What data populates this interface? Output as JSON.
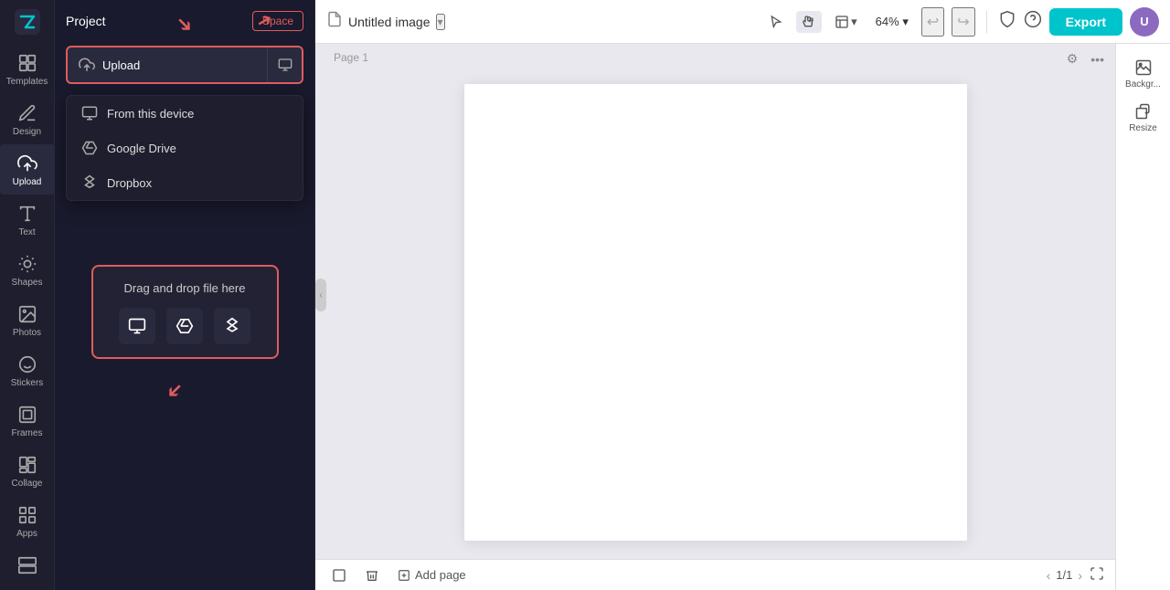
{
  "app": {
    "logo": "Z",
    "project_label": "Project",
    "space_label": "Space"
  },
  "sidebar": {
    "items": [
      {
        "id": "templates",
        "label": "Templates",
        "icon": "grid"
      },
      {
        "id": "design",
        "label": "Design",
        "icon": "pen"
      },
      {
        "id": "upload",
        "label": "Upload",
        "icon": "upload"
      },
      {
        "id": "text",
        "label": "Text",
        "icon": "text"
      },
      {
        "id": "shapes",
        "label": "Shapes",
        "icon": "shapes"
      },
      {
        "id": "photos",
        "label": "Photos",
        "icon": "photos"
      },
      {
        "id": "stickers",
        "label": "Stickers",
        "icon": "stickers"
      },
      {
        "id": "frames",
        "label": "Frames",
        "icon": "frames"
      },
      {
        "id": "collage",
        "label": "Collage",
        "icon": "collage"
      },
      {
        "id": "apps",
        "label": "Apps",
        "icon": "apps"
      }
    ],
    "active": "upload"
  },
  "upload_panel": {
    "upload_btn_label": "Upload",
    "dropdown": {
      "items": [
        {
          "id": "from-device",
          "label": "From this device",
          "icon": "monitor"
        },
        {
          "id": "google-drive",
          "label": "Google Drive",
          "icon": "google-drive"
        },
        {
          "id": "dropbox",
          "label": "Dropbox",
          "icon": "dropbox"
        }
      ]
    },
    "drag_drop": {
      "label": "Drag and drop file here",
      "icons": [
        {
          "id": "device",
          "icon": "monitor"
        },
        {
          "id": "drive",
          "icon": "google-drive"
        },
        {
          "id": "dropbox",
          "icon": "dropbox"
        }
      ]
    }
  },
  "header": {
    "doc_title": "Untitled image",
    "zoom": "64%",
    "export_label": "Export",
    "page_label": "Page 1"
  },
  "right_panel": {
    "items": [
      {
        "id": "background",
        "label": "Backgr..."
      },
      {
        "id": "resize",
        "label": "Resize"
      }
    ]
  },
  "bottom_bar": {
    "add_page_label": "Add page",
    "page_indicator": "1/1"
  }
}
